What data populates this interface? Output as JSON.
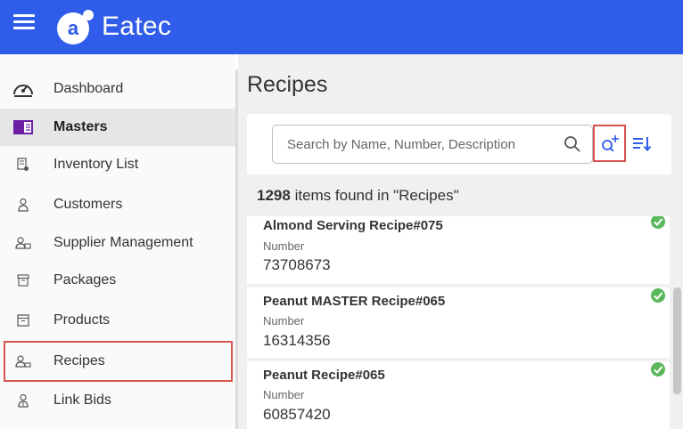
{
  "header": {
    "app_name": "Eatec",
    "brand_color": "#2f5ce8"
  },
  "sidebar": {
    "items": [
      {
        "label": "Dashboard",
        "icon": "dashboard-gauge-icon"
      },
      {
        "label": "Masters",
        "icon": "masters-book-icon",
        "state": "active-section"
      },
      {
        "label": "Inventory List",
        "icon": "inventory-list-icon"
      },
      {
        "label": "Customers",
        "icon": "customers-icon"
      },
      {
        "label": "Supplier Management",
        "icon": "supplier-icon"
      },
      {
        "label": "Packages",
        "icon": "packages-box-icon"
      },
      {
        "label": "Products",
        "icon": "products-icon"
      },
      {
        "label": "Recipes",
        "icon": "recipes-icon",
        "state": "highlighted"
      },
      {
        "label": "Link Bids",
        "icon": "link-bids-icon"
      }
    ]
  },
  "main": {
    "title": "Recipes",
    "search": {
      "placeholder": "Search by Name, Number, Description",
      "value": ""
    },
    "results": {
      "count": "1298",
      "suffix": "items found in \"Recipes\""
    },
    "items": [
      {
        "name": "Almond Serving Recipe#075",
        "number_label": "Number",
        "number": "73708673",
        "status": "check-icon"
      },
      {
        "name": "Peanut MASTER Recipe#065",
        "number_label": "Number",
        "number": "16314356",
        "status": "check-icon"
      },
      {
        "name": "Peanut Recipe#065",
        "number_label": "Number",
        "number": "60857420",
        "status": "check-icon"
      }
    ]
  },
  "colors": {
    "highlight_outline": "#d9534f",
    "accent_icon": "#2f5ce8",
    "status_green": "#5cb85c",
    "masters_icon": "#6a1fa3"
  }
}
